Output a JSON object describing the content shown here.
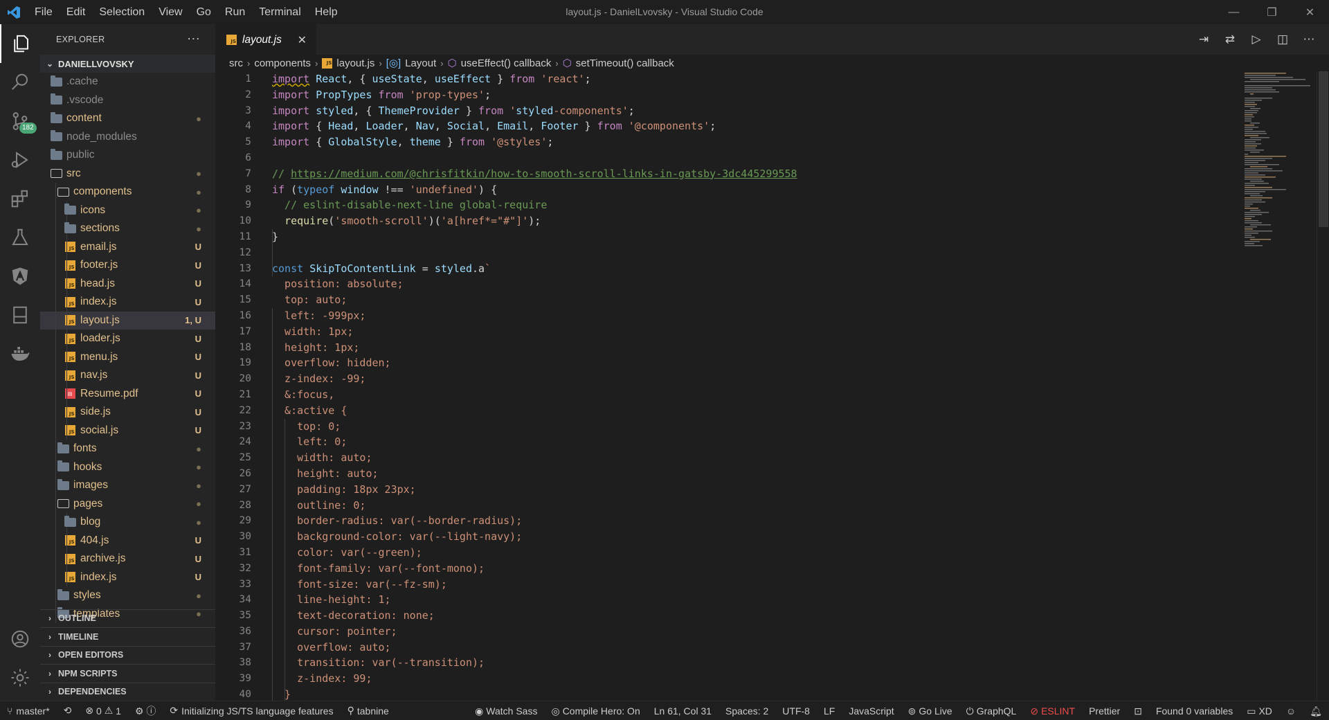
{
  "window": {
    "title": "layout.js - DanielLvovsky - Visual Studio Code",
    "menu": [
      "File",
      "Edit",
      "Selection",
      "View",
      "Go",
      "Run",
      "Terminal",
      "Help"
    ],
    "controls": {
      "minimize": "—",
      "restore": "❐",
      "close": "✕"
    }
  },
  "activity_bar": {
    "items": [
      "explorer",
      "search",
      "source-control",
      "run-debug",
      "extensions",
      "testing",
      "angular",
      "remote-explorer",
      "docker"
    ],
    "source_control_badge": "182",
    "bottom": [
      "accounts",
      "manage"
    ]
  },
  "sidebar": {
    "header": "EXPLORER",
    "more": "···",
    "root": "DANIELLVOVSKY",
    "tree": [
      {
        "name": ".cache",
        "depth": 0,
        "icon": "folder-gear",
        "status": ""
      },
      {
        "name": ".vscode",
        "depth": 0,
        "icon": "folder-vscode",
        "status": ""
      },
      {
        "name": "content",
        "depth": 0,
        "icon": "folder",
        "status": "●"
      },
      {
        "name": "node_modules",
        "depth": 0,
        "icon": "folder-node",
        "status": ""
      },
      {
        "name": "public",
        "depth": 0,
        "icon": "folder",
        "status": ""
      },
      {
        "name": "src",
        "depth": 0,
        "icon": "folder-open",
        "status": "●"
      },
      {
        "name": "components",
        "depth": 1,
        "icon": "folder-open",
        "status": "●"
      },
      {
        "name": "icons",
        "depth": 2,
        "icon": "folder",
        "status": "●"
      },
      {
        "name": "sections",
        "depth": 2,
        "icon": "folder",
        "status": "●"
      },
      {
        "name": "email.js",
        "depth": 2,
        "icon": "js",
        "status": "U"
      },
      {
        "name": "footer.js",
        "depth": 2,
        "icon": "js",
        "status": "U"
      },
      {
        "name": "head.js",
        "depth": 2,
        "icon": "js",
        "status": "U"
      },
      {
        "name": "index.js",
        "depth": 2,
        "icon": "js",
        "status": "U"
      },
      {
        "name": "layout.js",
        "depth": 2,
        "icon": "js",
        "status": "1, U",
        "selected": true
      },
      {
        "name": "loader.js",
        "depth": 2,
        "icon": "js",
        "status": "U"
      },
      {
        "name": "menu.js",
        "depth": 2,
        "icon": "js",
        "status": "U"
      },
      {
        "name": "nav.js",
        "depth": 2,
        "icon": "js",
        "status": "U"
      },
      {
        "name": "Resume.pdf",
        "depth": 2,
        "icon": "pdf",
        "status": "U"
      },
      {
        "name": "side.js",
        "depth": 2,
        "icon": "js",
        "status": "U"
      },
      {
        "name": "social.js",
        "depth": 2,
        "icon": "js",
        "status": "U"
      },
      {
        "name": "fonts",
        "depth": 1,
        "icon": "folder",
        "status": "●"
      },
      {
        "name": "hooks",
        "depth": 1,
        "icon": "folder",
        "status": "●"
      },
      {
        "name": "images",
        "depth": 1,
        "icon": "folder-images",
        "status": "●"
      },
      {
        "name": "pages",
        "depth": 1,
        "icon": "folder-open",
        "status": "●"
      },
      {
        "name": "blog",
        "depth": 2,
        "icon": "folder",
        "status": "●"
      },
      {
        "name": "404.js",
        "depth": 2,
        "icon": "js",
        "status": "U"
      },
      {
        "name": "archive.js",
        "depth": 2,
        "icon": "js",
        "status": "U"
      },
      {
        "name": "index.js",
        "depth": 2,
        "icon": "js",
        "status": "U"
      },
      {
        "name": "styles",
        "depth": 1,
        "icon": "folder",
        "status": "●"
      },
      {
        "name": "templates",
        "depth": 1,
        "icon": "folder",
        "status": "●"
      }
    ],
    "sections": [
      "OUTLINE",
      "TIMELINE",
      "OPEN EDITORS",
      "NPM SCRIPTS",
      "DEPENDENCIES"
    ]
  },
  "tabs": [
    {
      "label": "layout.js",
      "active": true,
      "close": "✕"
    }
  ],
  "editor_actions": [
    "open-changes",
    "compare",
    "run",
    "split-editor",
    "more"
  ],
  "breadcrumb": [
    "src",
    "components",
    "layout.js",
    "Layout",
    "useEffect() callback",
    "setTimeout() callback"
  ],
  "code": {
    "line_numbers": [
      "1",
      "2",
      "3",
      "4",
      "5",
      "6",
      "7",
      "8",
      "9",
      "10",
      "11",
      "12",
      "13",
      "14",
      "15",
      "16",
      "17",
      "18",
      "19",
      "20",
      "21",
      "22",
      "23",
      "24",
      "25",
      "26",
      "27",
      "28",
      "29",
      "30",
      "31",
      "32",
      "33",
      "34",
      "35",
      "36",
      "37",
      "38",
      "39",
      "40"
    ],
    "lines": [
      "import React, { useState, useEffect } from 'react';",
      "import PropTypes from 'prop-types';",
      "import styled, { ThemeProvider } from 'styled-components';",
      "import { Head, Loader, Nav, Social, Email, Footer } from '@components';",
      "import { GlobalStyle, theme } from '@styles';",
      "",
      "// https://medium.com/@chrisfitkin/how-to-smooth-scroll-links-in-gatsby-3dc445299558",
      "if (typeof window !== 'undefined') {",
      "  // eslint-disable-next-line global-require",
      "  require('smooth-scroll')('a[href*=\"#\"]');",
      "}",
      "",
      "const SkipToContentLink = styled.a`",
      "  position: absolute;",
      "  top: auto;",
      "  left: -999px;",
      "  width: 1px;",
      "  height: 1px;",
      "  overflow: hidden;",
      "  z-index: -99;",
      "  &:focus,",
      "  &:active {",
      "    top: 0;",
      "    left: 0;",
      "    width: auto;",
      "    height: auto;",
      "    padding: 18px 23px;",
      "    outline: 0;",
      "    border-radius: var(--border-radius);",
      "    background-color: var(--light-navy);",
      "    color: var(--green);",
      "    font-family: var(--font-mono);",
      "    font-size: var(--fz-sm);",
      "    line-height: 1;",
      "    text-decoration: none;",
      "    cursor: pointer;",
      "    overflow: auto;",
      "    transition: var(--transition);",
      "    z-index: 99;",
      "  }"
    ]
  },
  "statusbar": {
    "branch": "master*",
    "sync": "",
    "errors": "0",
    "warnings": "1",
    "ports": "",
    "loading": "Initializing JS/TS language features",
    "tabnine": "tabnine",
    "watch_sass": "Watch Sass",
    "compile_hero": "Compile Hero: On",
    "position": "Ln 61, Col 31",
    "spaces": "Spaces: 2",
    "encoding": "UTF-8",
    "eol": "LF",
    "language": "JavaScript",
    "go_live": "Go Live",
    "graphql": "GraphQL",
    "eslint": "ESLINT",
    "prettier": "Prettier",
    "variables": "Found 0 variables",
    "xd": "XD"
  },
  "colors": {
    "accent": "#007acc",
    "js_icon": "#e8a838",
    "modified_status": "#e2c08d",
    "untracked_status": "#73c991",
    "error": "#f14c4c"
  }
}
